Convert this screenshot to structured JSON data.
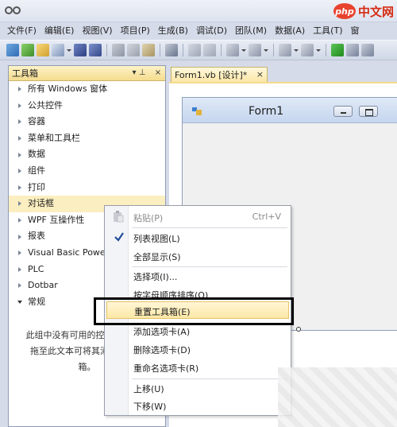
{
  "watermark": {
    "logo": "php",
    "text": "中文网"
  },
  "menubar": [
    "文件(F)",
    "编辑(E)",
    "视图(V)",
    "项目(P)",
    "生成(B)",
    "调试(D)",
    "团队(M)",
    "数据(A)",
    "工具(T)",
    "窗"
  ],
  "toolbox": {
    "title": "工具箱",
    "pin": "▾ ⊥",
    "close": "×",
    "categories": [
      "所有 Windows 窗体",
      "公共控件",
      "容器",
      "菜单和工具栏",
      "数据",
      "组件",
      "打印",
      "对话框",
      "WPF 互操作性",
      "报表",
      "Visual Basic PowerPacks",
      "PLC",
      "Dotbar",
      "常规"
    ],
    "empty_text": [
      "此组中没有可用的控件。将某项",
      "拖至此文本可将其添加到工具",
      "箱。"
    ]
  },
  "document": {
    "tab_label": "Form1.vb [设计]*",
    "tab_close": "×",
    "form_title": "Form1"
  },
  "context_menu": {
    "paste": {
      "label": "粘贴(P)",
      "shortcut": "Ctrl+V"
    },
    "list_view": "列表视图(L)",
    "show_all": "全部显示(S)",
    "choose_items": "选择项(I)...",
    "sort_alpha": "按字母顺序排序(O)",
    "reset_toolbox": "重置工具箱(E)",
    "add_tab": "添加选项卡(A)",
    "delete_tab": "删除选项卡(D)",
    "rename_tab": "重命名选项卡(R)",
    "move_up": "上移(U)",
    "move_down": "下移(W)"
  },
  "colors": {
    "toolbox_header": "#f5dc8e",
    "highlight": "#fde8a6",
    "chrome": "#d6dbe9"
  }
}
